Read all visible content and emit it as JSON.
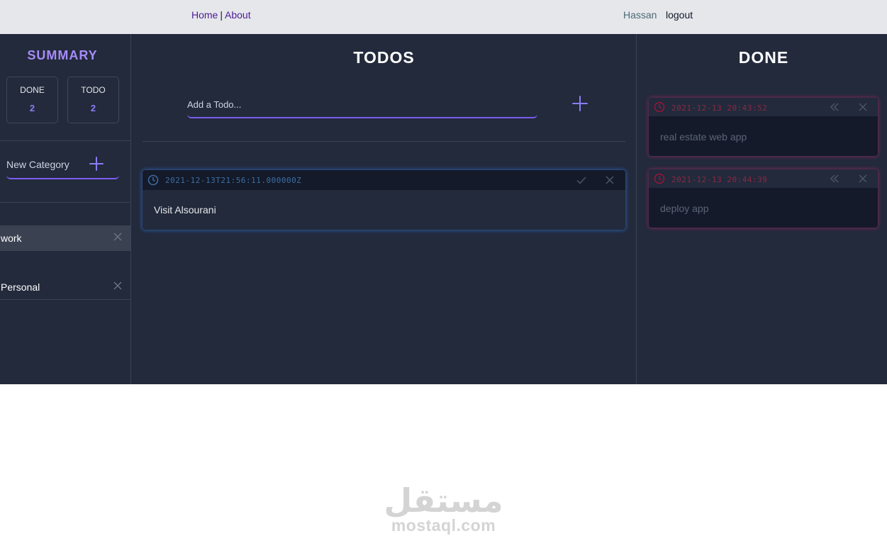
{
  "nav": {
    "home": "Home",
    "separator": "|",
    "about": "About"
  },
  "user": {
    "name": "Hassan",
    "logout": "logout"
  },
  "summary": {
    "title": "SUMMARY",
    "done_label": "DONE",
    "done_count": "2",
    "todo_label": "TODO",
    "todo_count": "2"
  },
  "category_input": {
    "placeholder": "New Category"
  },
  "categories": [
    {
      "name": "work"
    },
    {
      "name": "Personal"
    }
  ],
  "todos": {
    "title": "TODOS",
    "input_placeholder": "Add a Todo...",
    "items": [
      {
        "time": "2021-12-13T21:56:11.000000Z",
        "text": "Visit Alsourani"
      }
    ]
  },
  "done": {
    "title": "DONE",
    "items": [
      {
        "time": "2021-12-13 20:43:52",
        "text": "real estate web app"
      },
      {
        "time": "2021-12-13 20:44:39",
        "text": "deploy app"
      }
    ]
  },
  "watermark": {
    "arabic": "مستقل",
    "latin": "mostaql.com"
  },
  "colors": {
    "accent": "#8b7cf6",
    "panel_bg": "#222a3b",
    "todo_glow": "#3b82f6",
    "done_glow": "#db2777"
  }
}
